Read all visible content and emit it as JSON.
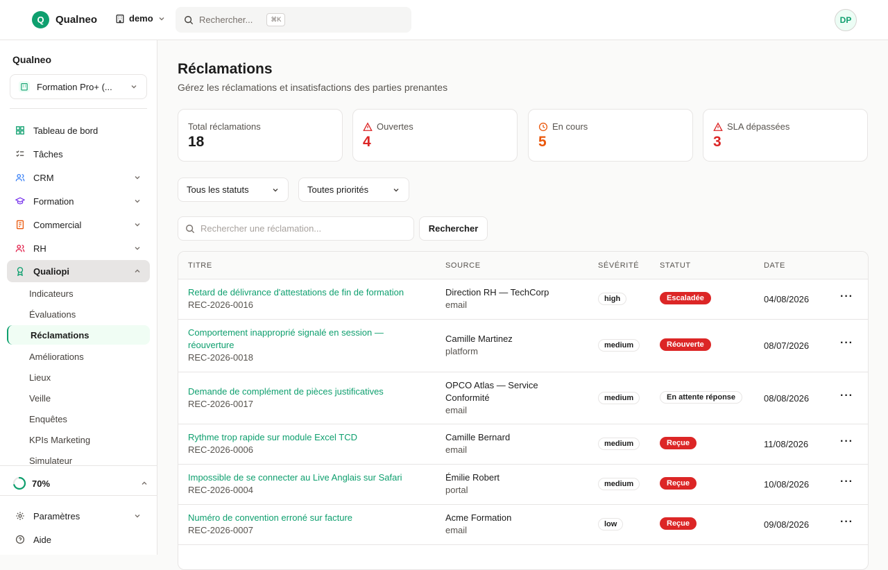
{
  "topbar": {
    "logo_letter": "Q",
    "app_name": "Qualneo",
    "workspace": "demo",
    "search_placeholder": "Rechercher...",
    "search_shortcut": "⌘K",
    "avatar_initials": "DP"
  },
  "sidebar": {
    "title": "Qualneo",
    "org": "Formation Pro+ (...",
    "nav": [
      {
        "label": "Tableau de bord"
      },
      {
        "label": "Tâches"
      },
      {
        "label": "CRM"
      },
      {
        "label": "Formation"
      },
      {
        "label": "Commercial"
      },
      {
        "label": "RH"
      },
      {
        "label": "Qualiopi"
      }
    ],
    "sub_items": [
      "Indicateurs",
      "Évaluations",
      "Réclamations",
      "Améliorations",
      "Lieux",
      "Veille",
      "Enquêtes",
      "KPIs Marketing",
      "Simulateur"
    ],
    "progress_label": "70%",
    "progress_value": 0.7,
    "bottom": [
      {
        "label": "Paramètres"
      },
      {
        "label": "Aide"
      }
    ]
  },
  "page": {
    "title": "Réclamations",
    "subtitle": "Gérez les réclamations et insatisfactions des parties prenantes"
  },
  "stats": [
    {
      "label": "Total réclamations",
      "value": "18",
      "color": "#1c1c1c"
    },
    {
      "label": "Ouvertes",
      "value": "4",
      "color": "#dc2626"
    },
    {
      "label": "En cours",
      "value": "5",
      "color": "#ea580c"
    },
    {
      "label": "SLA dépassées",
      "value": "3",
      "color": "#dc2626"
    }
  ],
  "filters": {
    "status": "Tous les statuts",
    "priority": "Toutes priorités",
    "search_placeholder": "Rechercher une réclamation...",
    "search_value": "",
    "search_button": "Rechercher"
  },
  "table": {
    "headers": [
      "TITRE",
      "SOURCE",
      "SÉVÉRITÉ",
      "STATUT",
      "DATE"
    ],
    "rows": [
      {
        "title": "Retard de délivrance d'attestations de fin de formation",
        "ref": "REC-2026-0016",
        "source": "Direction RH — TechCorp",
        "channel": "email",
        "severity": "high",
        "status": "Escaladée",
        "date": "04/08/2026"
      },
      {
        "title": "Comportement inapproprié signalé en session —",
        "title2": "réouverture",
        "ref": "REC-2026-0018",
        "source": "Camille Martinez",
        "channel": "platform",
        "severity": "medium",
        "status": "Réouverte",
        "date": "08/07/2026"
      },
      {
        "title": "Demande de complément de pièces justificatives",
        "ref": "REC-2026-0017",
        "source": "OPCO Atlas — Service",
        "source2": "Conformité",
        "channel": "email",
        "severity": "medium",
        "status": "En attente réponse",
        "date": "08/08/2026"
      },
      {
        "title": "Rythme trop rapide sur module Excel TCD",
        "ref": "REC-2026-0006",
        "source": "Camille Bernard",
        "channel": "email",
        "severity": "medium",
        "status": "Reçue",
        "date": "11/08/2026"
      },
      {
        "title": "Impossible de se connecter au Live Anglais sur Safari",
        "ref": "REC-2026-0004",
        "source": "Émilie Robert",
        "channel": "portal",
        "severity": "medium",
        "status": "Reçue",
        "date": "10/08/2026"
      },
      {
        "title": "Numéro de convention erroné sur facture",
        "ref": "REC-2026-0007",
        "source": "Acme Formation",
        "channel": "email",
        "severity": "low",
        "status": "Reçue",
        "date": "09/08/2026"
      }
    ],
    "actions_icon": "more-horizontal-icon"
  },
  "colors": {
    "brand": "#0e9f6e",
    "danger": "#dc2626",
    "warning": "#ea580c"
  }
}
